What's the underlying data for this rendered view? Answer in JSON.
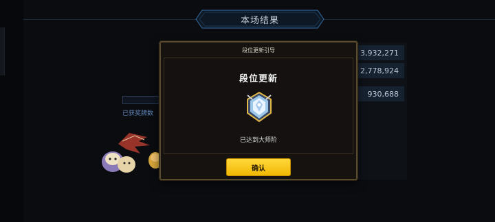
{
  "header": {
    "title": "本场结果"
  },
  "scores": [
    "3,932,271",
    "2,778,924",
    "930,688"
  ],
  "medals": {
    "label": "已获奖牌数"
  },
  "modal": {
    "title": "段位更新引导",
    "heading": "段位更新",
    "message": "已达到大师阶",
    "confirm_label": "确认",
    "emblem_icon": "grandmaster-rank-emblem"
  },
  "colors": {
    "accent_yellow": "#f2b705",
    "modal_border": "#5a4a2c",
    "score_bg": "#172231"
  }
}
